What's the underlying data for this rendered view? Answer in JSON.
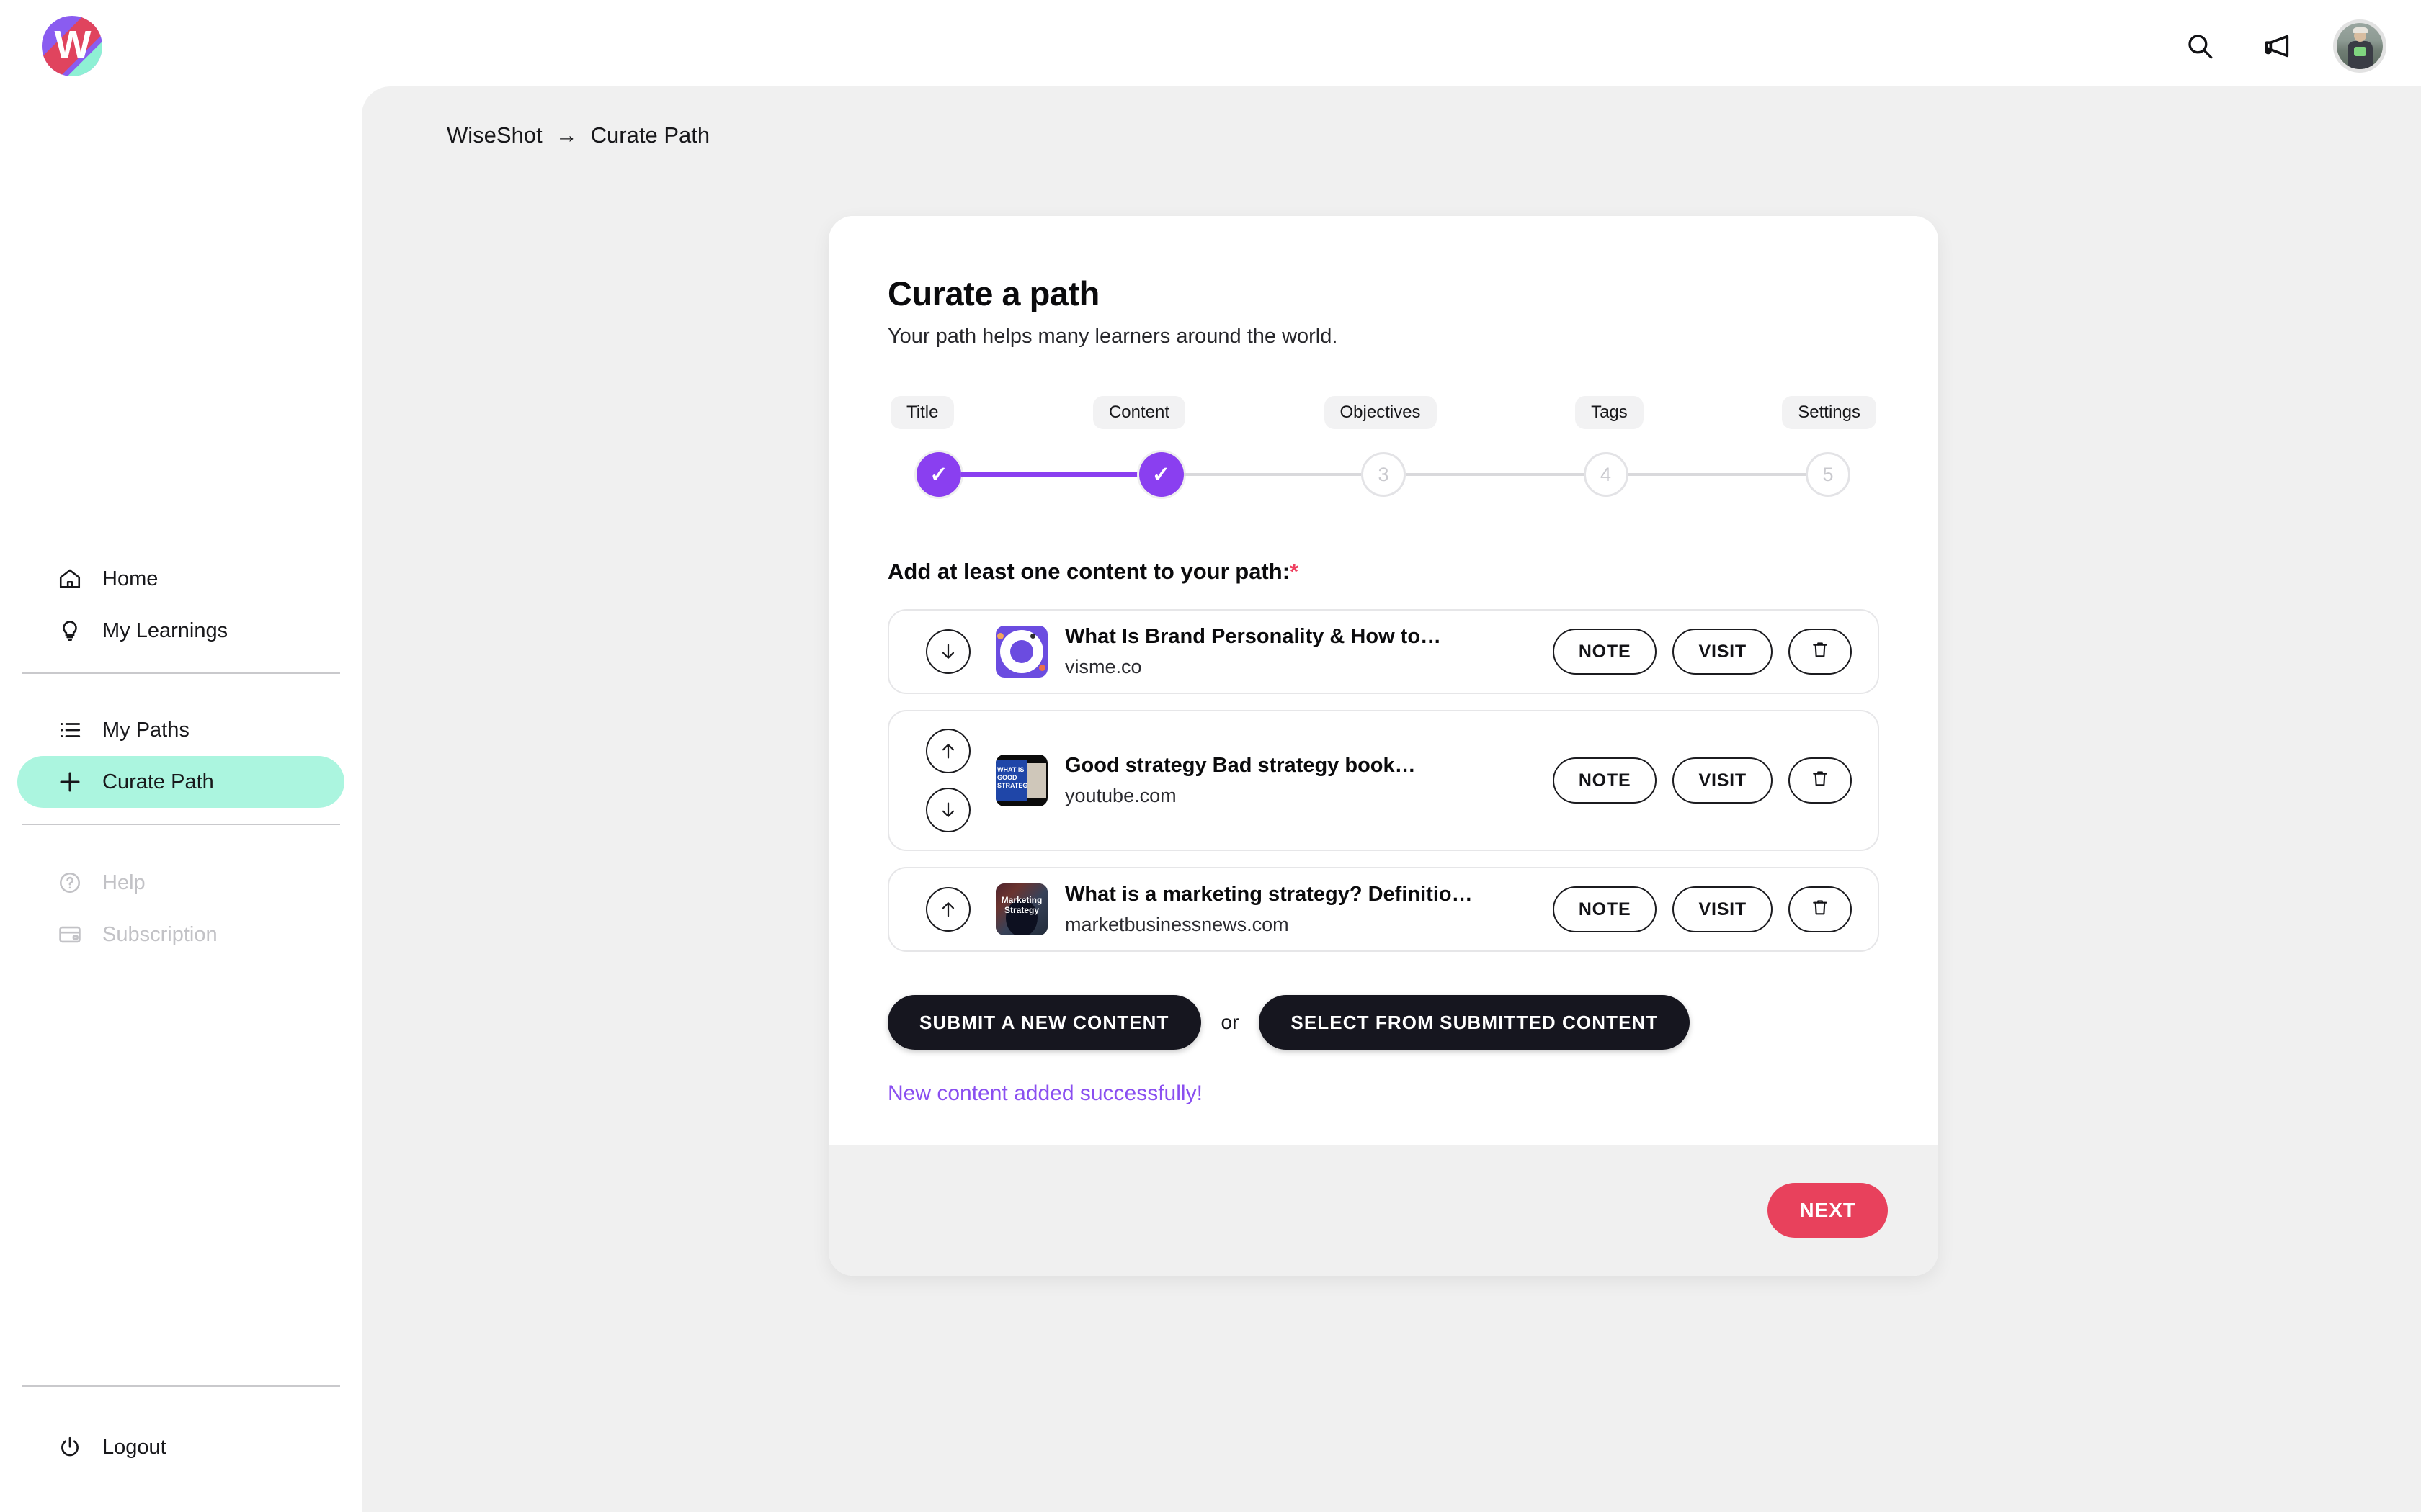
{
  "app": {
    "logo_letter": "W",
    "logo_name": "wiseshot-logo"
  },
  "topbar": {
    "search_icon": "search-icon",
    "announcements_icon": "megaphone-icon",
    "avatar_name": "user-avatar"
  },
  "sidebar": {
    "primary": [
      {
        "label": "Home",
        "icon": "home-icon",
        "state": "default"
      },
      {
        "label": "My Learnings",
        "icon": "lightbulb-icon",
        "state": "default"
      }
    ],
    "paths": [
      {
        "label": "My Paths",
        "icon": "list-icon",
        "state": "default"
      },
      {
        "label": "Curate Path",
        "icon": "plus-icon",
        "state": "active"
      }
    ],
    "secondary": [
      {
        "label": "Help",
        "icon": "question-circle-icon",
        "state": "disabled"
      },
      {
        "label": "Subscription",
        "icon": "card-icon",
        "state": "disabled"
      }
    ],
    "logout": {
      "label": "Logout",
      "icon": "power-icon"
    }
  },
  "breadcrumb": {
    "root": "WiseShot",
    "arrow": "→",
    "current": "Curate Path"
  },
  "card": {
    "title": "Curate a path",
    "subtitle": "Your path helps many learners around the world.",
    "steps": [
      {
        "label": "Title",
        "marker": "✓",
        "state": "done"
      },
      {
        "label": "Content",
        "marker": "✓",
        "state": "done"
      },
      {
        "label": "Objectives",
        "marker": "3",
        "state": "todo"
      },
      {
        "label": "Tags",
        "marker": "4",
        "state": "todo"
      },
      {
        "label": "Settings",
        "marker": "5",
        "state": "todo"
      }
    ],
    "section_label": "Add at least one content to your path:",
    "required_mark": "*",
    "contents": [
      {
        "title": "What Is Brand Personality & How to…",
        "source": "visme.co",
        "thumb": "visme-thumbnail",
        "move_up": false,
        "move_down": true,
        "note_label": "NOTE",
        "visit_label": "VISIT",
        "delete_icon": "trash-icon"
      },
      {
        "title": "Good strategy Bad strategy book…",
        "source": "youtube.com",
        "thumb": "youtube-thumbnail",
        "move_up": true,
        "move_down": true,
        "note_label": "NOTE",
        "visit_label": "VISIT",
        "delete_icon": "trash-icon"
      },
      {
        "title": "What is a marketing strategy? Definitio…",
        "source": "marketbusinessnews.com",
        "thumb": "marketbusinessnews-thumbnail",
        "move_up": true,
        "move_down": false,
        "note_label": "NOTE",
        "visit_label": "VISIT",
        "delete_icon": "trash-icon"
      }
    ],
    "submit_new_label": "SUBMIT A NEW CONTENT",
    "or_label": "or",
    "select_submitted_label": "SELECT FROM SUBMITTED CONTENT",
    "success_message": "New content added successfully!",
    "next_label": "NEXT"
  },
  "thumb_text": {
    "youtube_line1": "WHAT IS",
    "youtube_line2": "GOOD",
    "youtube_line3": "STRATEGY?",
    "mbn_line1": "Marketing",
    "mbn_line2": "Strategy"
  },
  "colors": {
    "accent_purple": "#8a3ff0",
    "accent_pink": "#e8415c",
    "active_mint": "#abf5df",
    "page_bg": "#f0f0f0",
    "dark_button": "#16161f"
  }
}
